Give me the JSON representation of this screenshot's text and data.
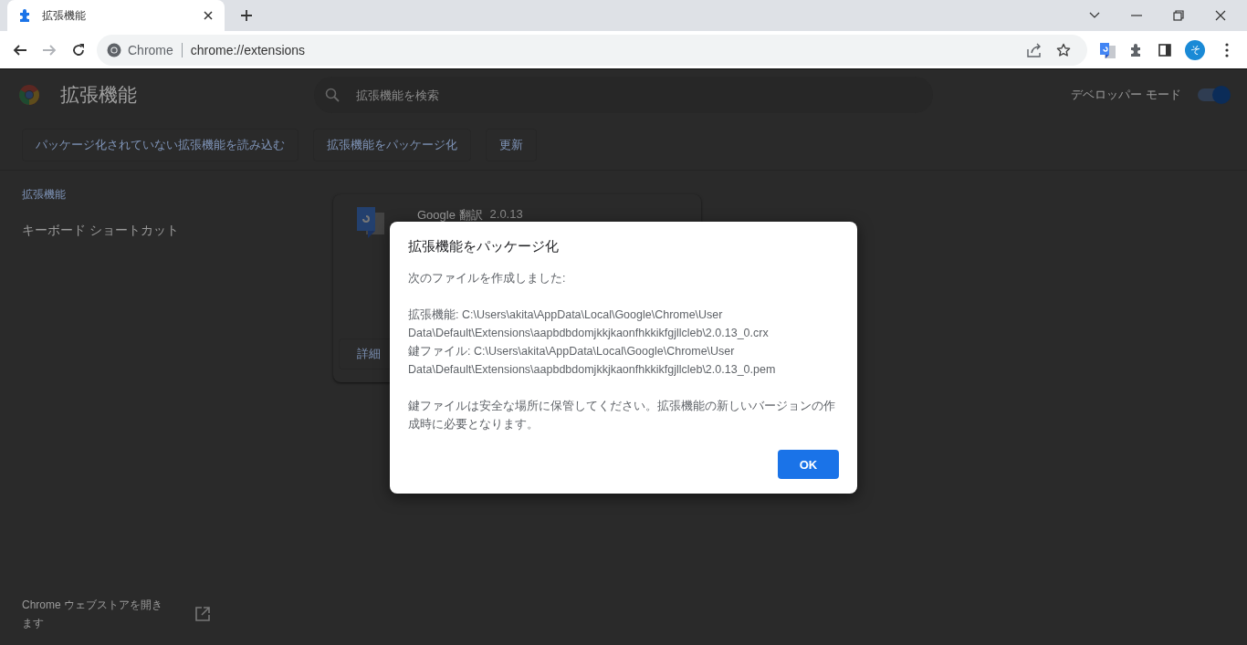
{
  "window": {
    "tab": {
      "title": "拡張機能",
      "selected": true
    },
    "nav_buttons": [
      {
        "kind": "back",
        "disabled": false
      },
      {
        "kind": "forward",
        "disabled": true
      },
      {
        "kind": "reload",
        "disabled": false
      }
    ],
    "address": {
      "site_label": "Chrome",
      "url": "chrome://extensions"
    },
    "avatar": "そ"
  },
  "page": {
    "title": "拡張機能",
    "search": {
      "placeholder": "拡張機能を検索"
    },
    "developer_mode": {
      "label": "デベロッパー モード",
      "on": true
    },
    "toolbar_buttons": [
      "パッケージ化されていない拡張機能を読み込む",
      "拡張機能をパッケージ化",
      "更新"
    ],
    "sidebar": {
      "items": [
        {
          "label": "拡張機能",
          "selected": true
        },
        {
          "label": "キーボード ショートカット",
          "selected": false
        }
      ],
      "store_link": "Chrome ウェブストアを開きます"
    },
    "extension_card": {
      "name": "Google 翻訳",
      "version": "2.0.13",
      "details_button": "詳細"
    }
  },
  "dialog": {
    "title": "拡張機能をパッケージ化",
    "intro": "次のファイルを作成しました:",
    "files": [
      {
        "label": "拡張機能:",
        "path": "C:\\Users\\akita\\AppData\\Local\\Google\\Chrome\\User Data\\Default\\Extensions\\aapbdbdomjkkjkaonfhkkikfgjllcleb\\2.0.13_0.crx"
      },
      {
        "label": "鍵ファイル:",
        "path": "C:\\Users\\akita\\AppData\\Local\\Google\\Chrome\\User Data\\Default\\Extensions\\aapbdbdomjkkjkaonfhkkikfgjllcleb\\2.0.13_0.pem"
      }
    ],
    "note": "鍵ファイルは安全な場所に保管してください。拡張機能の新しいバージョンの作成時に必要となります。",
    "button": "OK"
  }
}
